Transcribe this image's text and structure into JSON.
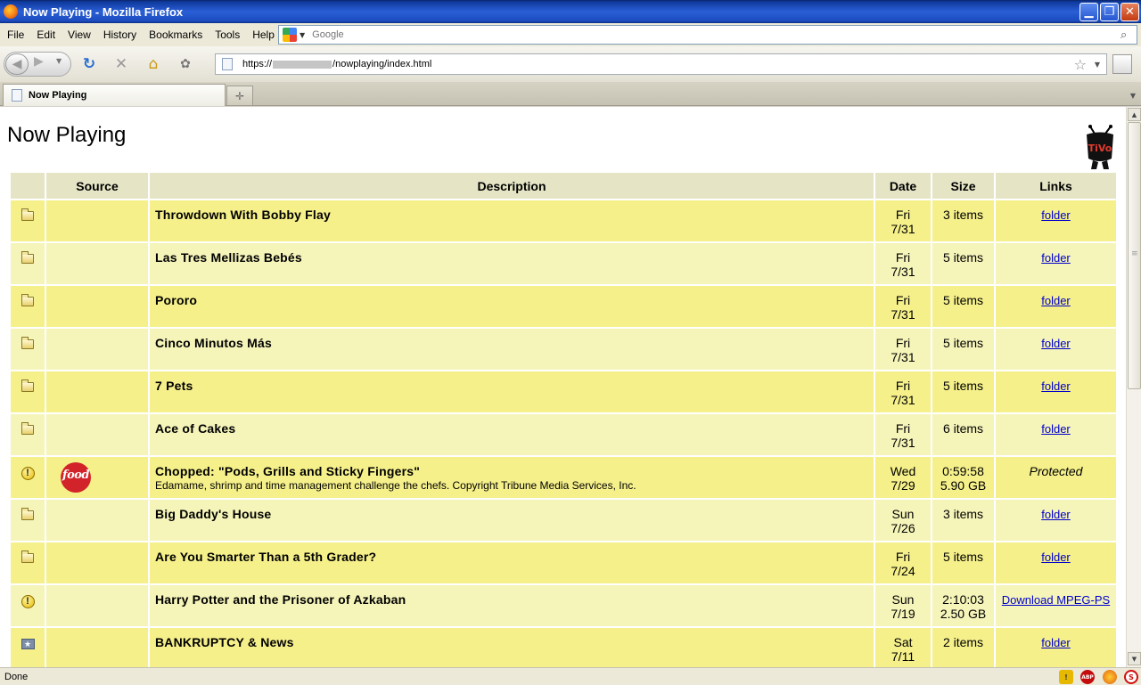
{
  "window": {
    "title": "Now Playing - Mozilla Firefox",
    "min": "▁",
    "max": "❐",
    "close": "✕"
  },
  "menu": [
    "File",
    "Edit",
    "View",
    "History",
    "Bookmarks",
    "Tools",
    "Help"
  ],
  "search": {
    "placeholder": "Google",
    "engine_icon": "google-icon"
  },
  "nav": {
    "url_prefix": "https://",
    "url_suffix": "/nowplaying/index.html"
  },
  "tabs": [
    {
      "label": "Now Playing",
      "active": true
    }
  ],
  "page": {
    "title": "Now Playing",
    "logo": "TiVo",
    "columns": [
      "",
      "Source",
      "Description",
      "Date",
      "Size",
      "Links"
    ],
    "rows": [
      {
        "icon": "folder-icon",
        "source": "",
        "title": "Throwdown With Bobby Flay",
        "subtitle": "",
        "day": "Fri",
        "date": "7/31",
        "size1": "3 items",
        "size2": "",
        "link": "folder",
        "link_type": "link"
      },
      {
        "icon": "folder-icon",
        "source": "",
        "title": "Las Tres Mellizas Bebés",
        "subtitle": "",
        "day": "Fri",
        "date": "7/31",
        "size1": "5 items",
        "size2": "",
        "link": "folder",
        "link_type": "link"
      },
      {
        "icon": "folder-icon",
        "source": "",
        "title": "Pororo",
        "subtitle": "",
        "day": "Fri",
        "date": "7/31",
        "size1": "5 items",
        "size2": "",
        "link": "folder",
        "link_type": "link"
      },
      {
        "icon": "folder-icon",
        "source": "",
        "title": "Cinco Minutos Más",
        "subtitle": "",
        "day": "Fri",
        "date": "7/31",
        "size1": "5 items",
        "size2": "",
        "link": "folder",
        "link_type": "link"
      },
      {
        "icon": "folder-icon",
        "source": "",
        "title": "7 Pets",
        "subtitle": "",
        "day": "Fri",
        "date": "7/31",
        "size1": "5 items",
        "size2": "",
        "link": "folder",
        "link_type": "link"
      },
      {
        "icon": "folder-icon",
        "source": "",
        "title": "Ace of Cakes",
        "subtitle": "",
        "day": "Fri",
        "date": "7/31",
        "size1": "6 items",
        "size2": "",
        "link": "folder",
        "link_type": "link"
      },
      {
        "icon": "warning-icon",
        "source": "food",
        "title": "Chopped: \"Pods, Grills and Sticky Fingers\"",
        "subtitle": "Edamame, shrimp and time management challenge the chefs. Copyright Tribune Media Services, Inc.",
        "day": "Wed",
        "date": "7/29",
        "size1": "0:59:58",
        "size2": "5.90 GB",
        "link": "Protected",
        "link_type": "text"
      },
      {
        "icon": "folder-icon",
        "source": "",
        "title": "Big Daddy's House",
        "subtitle": "",
        "day": "Sun",
        "date": "7/26",
        "size1": "3 items",
        "size2": "",
        "link": "folder",
        "link_type": "link"
      },
      {
        "icon": "folder-icon",
        "source": "",
        "title": "Are You Smarter Than a 5th Grader?",
        "subtitle": "",
        "day": "Fri",
        "date": "7/24",
        "size1": "5 items",
        "size2": "",
        "link": "folder",
        "link_type": "link"
      },
      {
        "icon": "warning-icon",
        "source": "",
        "title": "Harry Potter and the Prisoner of Azkaban",
        "subtitle": "",
        "day": "Sun",
        "date": "7/19",
        "size1": "2:10:03",
        "size2": "2.50 GB",
        "link": "Download MPEG-PS",
        "link_type": "link"
      },
      {
        "icon": "star-folder-icon",
        "source": "",
        "title": "BANKRUPTCY & News",
        "subtitle": "",
        "day": "Sat",
        "date": "7/11",
        "size1": "2 items",
        "size2": "",
        "link": "folder",
        "link_type": "link"
      }
    ]
  },
  "status": {
    "text": "Done",
    "abp": "ABP"
  },
  "colors": {
    "row_odd": "#f5f08a",
    "row_even": "#f5f4b9",
    "header": "#e5e5c6",
    "link": "#0000cc"
  }
}
